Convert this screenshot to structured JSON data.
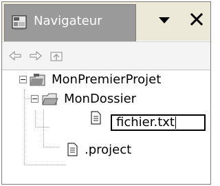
{
  "view": {
    "title": "Navigateur",
    "tab_icon": "navigator-icon",
    "menu_icon": "view-menu-icon",
    "close_icon": "close-icon"
  },
  "toolbar": {
    "items": [
      {
        "name": "back-icon"
      },
      {
        "name": "forward-icon"
      },
      {
        "name": "up-folder-icon"
      }
    ]
  },
  "tree": {
    "items": [
      {
        "label": "MonPremierProjet",
        "icon": "project-folder-icon",
        "expanded": true
      },
      {
        "label": "MonDossier",
        "icon": "folder-icon",
        "expanded": true
      },
      {
        "label": "fichier.txt",
        "icon": "file-icon",
        "editing": true
      },
      {
        "label": ".project",
        "icon": "file-icon"
      }
    ]
  },
  "colors": {
    "tab_bg": "#9a9a9a",
    "title_text": "#ffffff"
  }
}
